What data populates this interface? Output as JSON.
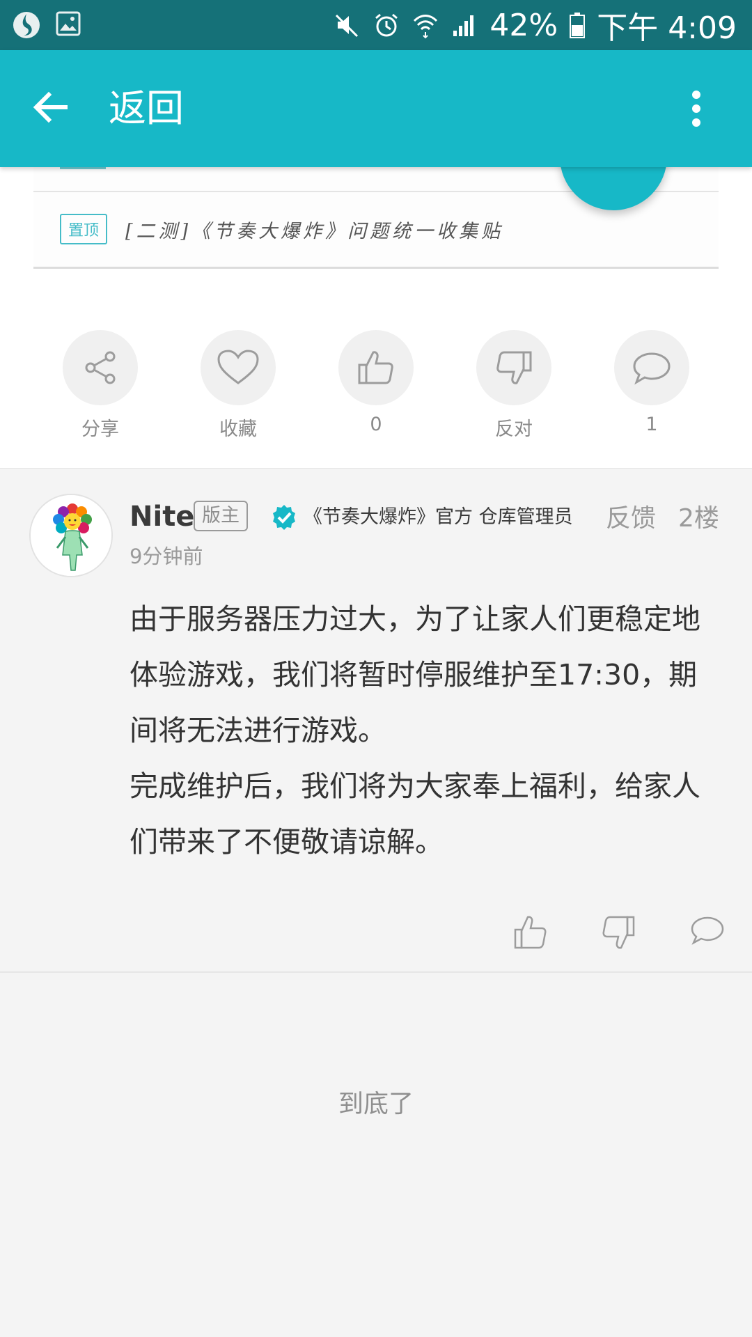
{
  "status_bar": {
    "battery": "42%",
    "time": "下午 4:09"
  },
  "app_bar": {
    "title": "返回"
  },
  "pinned": {
    "tag": "置顶",
    "title": "[二测]《节奏大爆炸》问题统一收集贴"
  },
  "actions": [
    {
      "icon": "share-icon",
      "label": "分享"
    },
    {
      "icon": "heart-icon",
      "label": "收藏"
    },
    {
      "icon": "thumbs-up-icon",
      "label": "0"
    },
    {
      "icon": "thumbs-down-icon",
      "label": "反对"
    },
    {
      "icon": "comment-icon",
      "label": "1"
    }
  ],
  "post": {
    "username": "Nite",
    "badge": "版主",
    "verified_text": "《节奏大爆炸》官方 仓库管理员",
    "feedback": "反馈",
    "floor": "2楼",
    "time": "9分钟前",
    "body_p1": "由于服务器压力过大，为了让家人们更稳定地体验游戏，我们将暂时停服维护至17:30，期间将无法进行游戏。",
    "body_p2": "完成维护后，我们将为大家奉上福利，给家人们带来了不便敬请谅解。"
  },
  "footer": {
    "end_text": "到底了"
  },
  "colors": {
    "status_bar": "#157178",
    "app_bar": "#17b8c7",
    "accent": "#17b8c7"
  }
}
